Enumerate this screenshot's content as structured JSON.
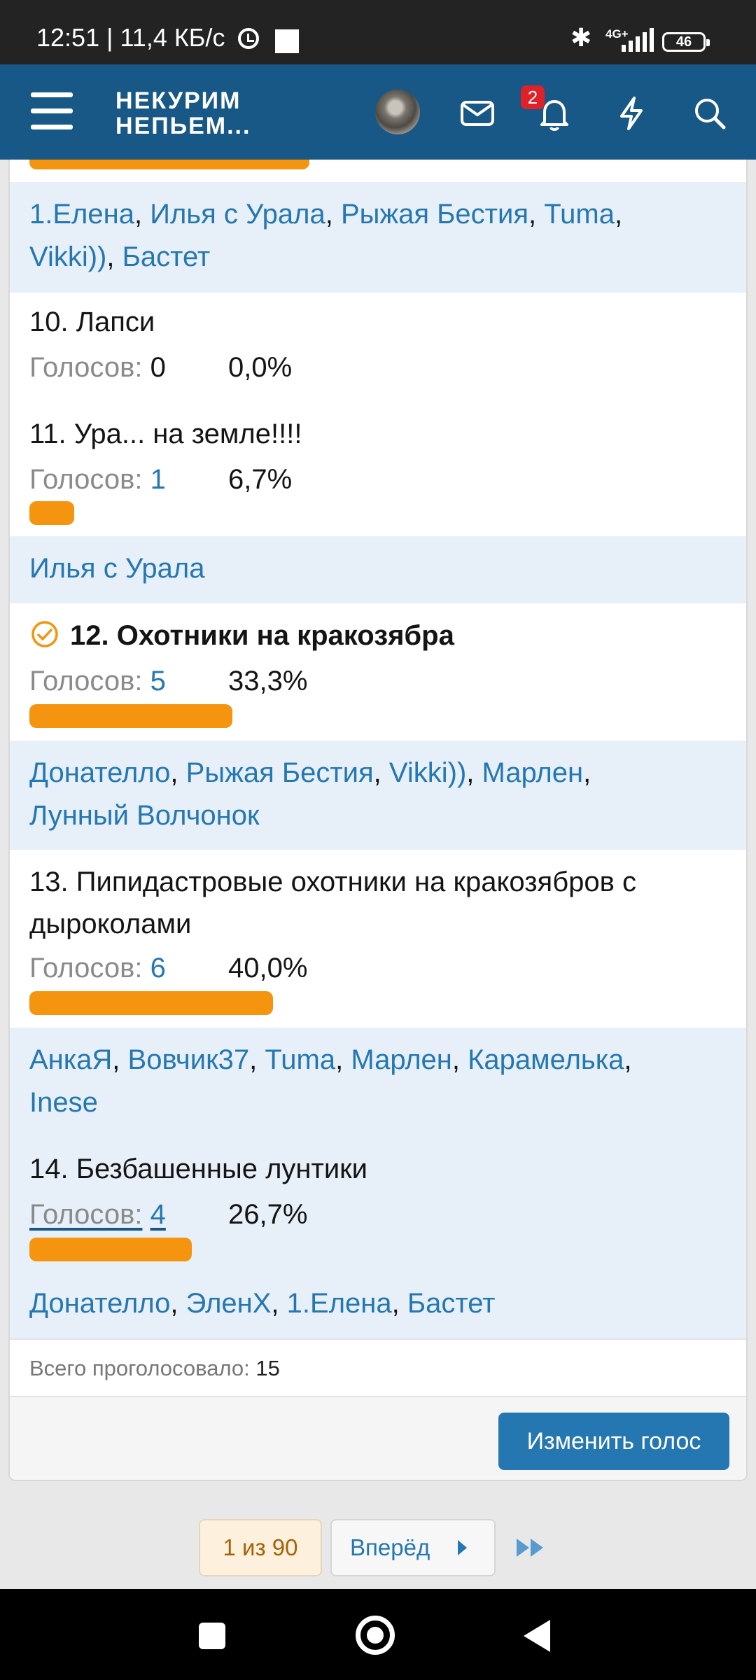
{
  "status_bar": {
    "time_speed": "12:51 | 11,4 КБ/с",
    "network": "4G+",
    "battery": "46"
  },
  "header": {
    "logo_line1": "НЕКУРИМ",
    "logo_line2": "НЕПЬЕМ...",
    "notifications_count": "2",
    "colors": {
      "header_bg": "#185886",
      "badge": "#e0212a"
    }
  },
  "poll": {
    "colors": {
      "bar": "#f4940f",
      "link": "#2577b1",
      "voters_bg": "#e7f0f8"
    },
    "votes_label": "Голосов:",
    "top_voters": [
      "1.Елена",
      "Илья с Урала",
      "Рыжая Бестия",
      "Tuma",
      "Vikki))",
      "Бастет"
    ],
    "options": [
      {
        "title": "10. Лапси",
        "votes": "0",
        "percent": "0,0%",
        "fraction": 0.0,
        "voters": []
      },
      {
        "title": "11. Ура... на земле!!!!",
        "votes": "1",
        "percent": "6,7%",
        "fraction": 0.067,
        "voters": [
          "Илья с Урала"
        ]
      },
      {
        "title": "12. Охотники на кракозябра",
        "votes": "5",
        "percent": "33,3%",
        "fraction": 0.333,
        "selected": true,
        "voters": [
          "Донателло",
          "Рыжая Бестия",
          "Vikki))",
          "Марлен",
          "Лунный Волчонок"
        ]
      },
      {
        "title_line1": "13. Пипидастровые охотники на кракозябров с",
        "title_line2": "дыроколами",
        "votes": "6",
        "percent": "40,0%",
        "fraction": 0.4,
        "voters": [
          "АнкаЯ",
          "Вовчик37",
          "Tuma",
          "Марлен",
          "Карамелька",
          "Inese"
        ]
      },
      {
        "title": "14. Безбашенные лунтики",
        "votes": "4",
        "percent": "26,7%",
        "fraction": 0.267,
        "voters": [
          "Донателло",
          "ЭленХ",
          "1.Елена",
          "Бастет"
        ]
      }
    ],
    "total_label": "Всего проголосовало:",
    "total_count": "15",
    "change_vote_label": "Изменить голос"
  },
  "pagination": {
    "current": "1 из 90",
    "next_label": "Вперёд"
  }
}
